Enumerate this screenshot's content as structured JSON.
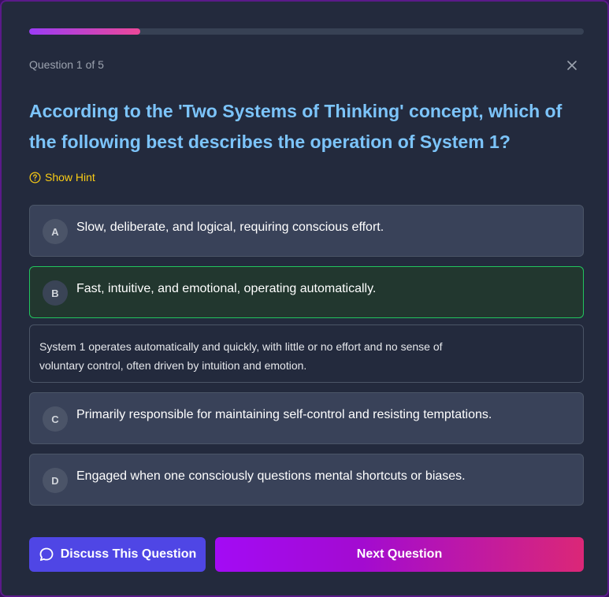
{
  "progress": {
    "fraction": 0.2
  },
  "header": {
    "counter": "Question 1 of 5",
    "close_icon": "close-icon"
  },
  "question": {
    "text": "According to the 'Two Systems of Thinking' concept, which of the following best describes the operation of System 1?"
  },
  "hint": {
    "label": "Show Hint",
    "icon": "question-circle-icon"
  },
  "options": [
    {
      "letter": "A",
      "text": "Slow, deliberate, and logical, requiring conscious effort.",
      "state": "default"
    },
    {
      "letter": "B",
      "text": "Fast, intuitive, and emotional, operating automatically.",
      "state": "correct"
    },
    {
      "letter": "C",
      "text": "Primarily responsible for maintaining self-control and resisting temptations.",
      "state": "default"
    },
    {
      "letter": "D",
      "text": "Engaged when one consciously questions mental shortcuts or biases.",
      "state": "default"
    }
  ],
  "explanation": {
    "text": "System 1 operates automatically and quickly, with little or no effort and no sense of voluntary control, often driven by intuition and emotion."
  },
  "actions": {
    "discuss_label": "Discuss This Question",
    "discuss_icon": "chat-bubble-icon",
    "next_label": "Next Question"
  },
  "colors": {
    "accent_blue": "#7cc4fa",
    "hint_yellow": "#facc15",
    "correct_green": "#22c55e",
    "discuss_indigo": "#4f46e5",
    "next_gradient_start": "#a30bf5",
    "next_gradient_end": "#db2777"
  }
}
